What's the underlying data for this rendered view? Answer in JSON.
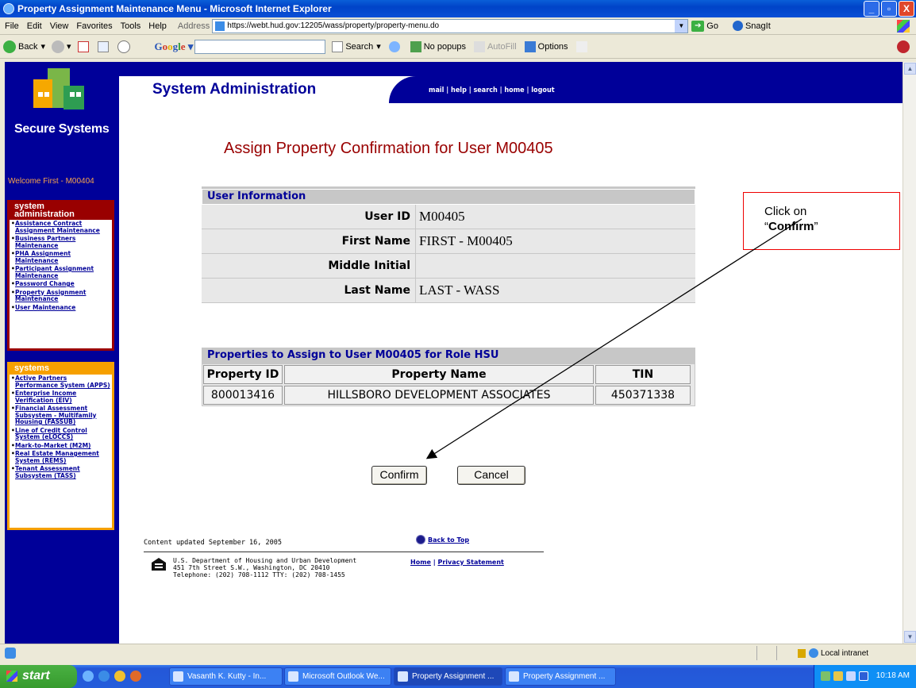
{
  "window": {
    "title": "Property Assignment Maintenance Menu - Microsoft Internet Explorer",
    "controls": [
      "_",
      "▫",
      "X"
    ]
  },
  "menubar": {
    "items": [
      "File",
      "Edit",
      "View",
      "Favorites",
      "Tools",
      "Help"
    ],
    "address_label": "Address",
    "url": "https://webt.hud.gov:12205/wass/property/property-menu.do",
    "go_label": "Go",
    "snagit_label": "SnagIt"
  },
  "toolbar": {
    "back_label": "Back",
    "google_search_label": "Search",
    "popups_label": "No popups",
    "autofill_label": "AutoFill",
    "options_label": "Options"
  },
  "header": {
    "title": "System Administration",
    "links": [
      "mail",
      "help",
      "search",
      "home",
      "logout"
    ],
    "separator": " | "
  },
  "sidebar": {
    "brand": "Secure Systems",
    "welcome": "Welcome First - M00404",
    "sysadmin_title_line1": "system",
    "sysadmin_title_line2": "administration",
    "sysadmin_links": [
      "Assistance Contract Assignment Maintenance",
      "Business Partners Maintenance",
      "PHA Assignment Maintenance",
      "Participant Assignment Maintenance",
      "Password Change",
      "Property Assignment Maintenance",
      "User Maintenance"
    ],
    "systems_title": "systems",
    "systems_links": [
      "Active Partners Performance System (APPS)",
      "Enterprise Income Verification (EIV)",
      "Financial Assessment Subsystem - Multifamily Housing (FASSUB)",
      "Line of Credit Control System (eLOCCS)",
      "Mark-to-Market (M2M)",
      "Real Estate Management System (REMS)",
      "Tenant Assessment Subsystem (TASS)"
    ]
  },
  "main": {
    "page_title": "Assign Property Confirmation for User M00405",
    "user_info": {
      "header": "User Information",
      "rows": [
        {
          "label": "User ID",
          "value": "M00405"
        },
        {
          "label": "First Name",
          "value": "FIRST - M00405"
        },
        {
          "label": "Middle Initial",
          "value": ""
        },
        {
          "label": "Last Name",
          "value": "LAST - WASS"
        }
      ]
    },
    "properties": {
      "header": "Properties to Assign to User M00405 for Role HSU",
      "columns": [
        "Property ID",
        "Property Name",
        "TIN"
      ],
      "rows": [
        [
          "800013416",
          "HILLSBORO DEVELOPMENT ASSOCIATES",
          "450371338"
        ]
      ]
    },
    "confirm_label": "Confirm",
    "cancel_label": "Cancel"
  },
  "callout": {
    "line1": "Click on",
    "open_quote": "“",
    "emph": "Confirm",
    "close_quote": "”"
  },
  "footer": {
    "updated": "Content updated September 16, 2005",
    "back_to_top": "Back to Top",
    "address_lines": "U.S. Department of Housing and Urban Development\n451 7th Street S.W., Washington, DC 20410\nTelephone: (202) 708-1112 TTY: (202) 708-1455",
    "home_link": "Home",
    "privacy_link": "Privacy Statement",
    "links_sep": " | "
  },
  "statusbar": {
    "zone": "Local intranet"
  },
  "taskbar": {
    "start_label": "start",
    "tasks": [
      "Vasanth K. Kutty - In...",
      "Microsoft Outlook We...",
      "Property Assignment ...",
      "Property Assignment ..."
    ],
    "clock": "10:18 AM"
  },
  "colors": {
    "navy": "#000099",
    "maroon": "#990000",
    "orange": "#f6a000",
    "callout_border": "#ee0000"
  }
}
